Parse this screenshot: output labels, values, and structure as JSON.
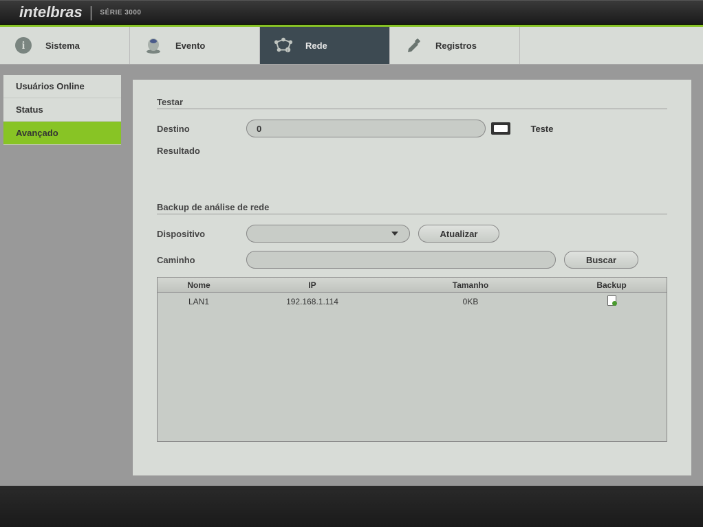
{
  "header": {
    "brand": "intelbras",
    "series": "SÉRIE 3000"
  },
  "nav": {
    "sistema": "Sistema",
    "evento": "Evento",
    "rede": "Rede",
    "registros": "Registros"
  },
  "sidebar": {
    "usuarios_online": "Usuários Online",
    "status": "Status",
    "avancado": "Avançado"
  },
  "content": {
    "testar_title": "Testar",
    "destino_label": "Destino",
    "destino_value": "0",
    "teste_btn": "Teste",
    "resultado_label": "Resultado",
    "backup_title": "Backup de análise de rede",
    "dispositivo_label": "Dispositivo",
    "atualizar_btn": "Atualizar",
    "caminho_label": "Caminho",
    "caminho_value": "",
    "buscar_btn": "Buscar"
  },
  "table": {
    "headers": {
      "nome": "Nome",
      "ip": "IP",
      "tamanho": "Tamanho",
      "backup": "Backup"
    },
    "rows": [
      {
        "nome": "LAN1",
        "ip": "192.168.1.114",
        "tamanho": "0KB"
      }
    ]
  }
}
